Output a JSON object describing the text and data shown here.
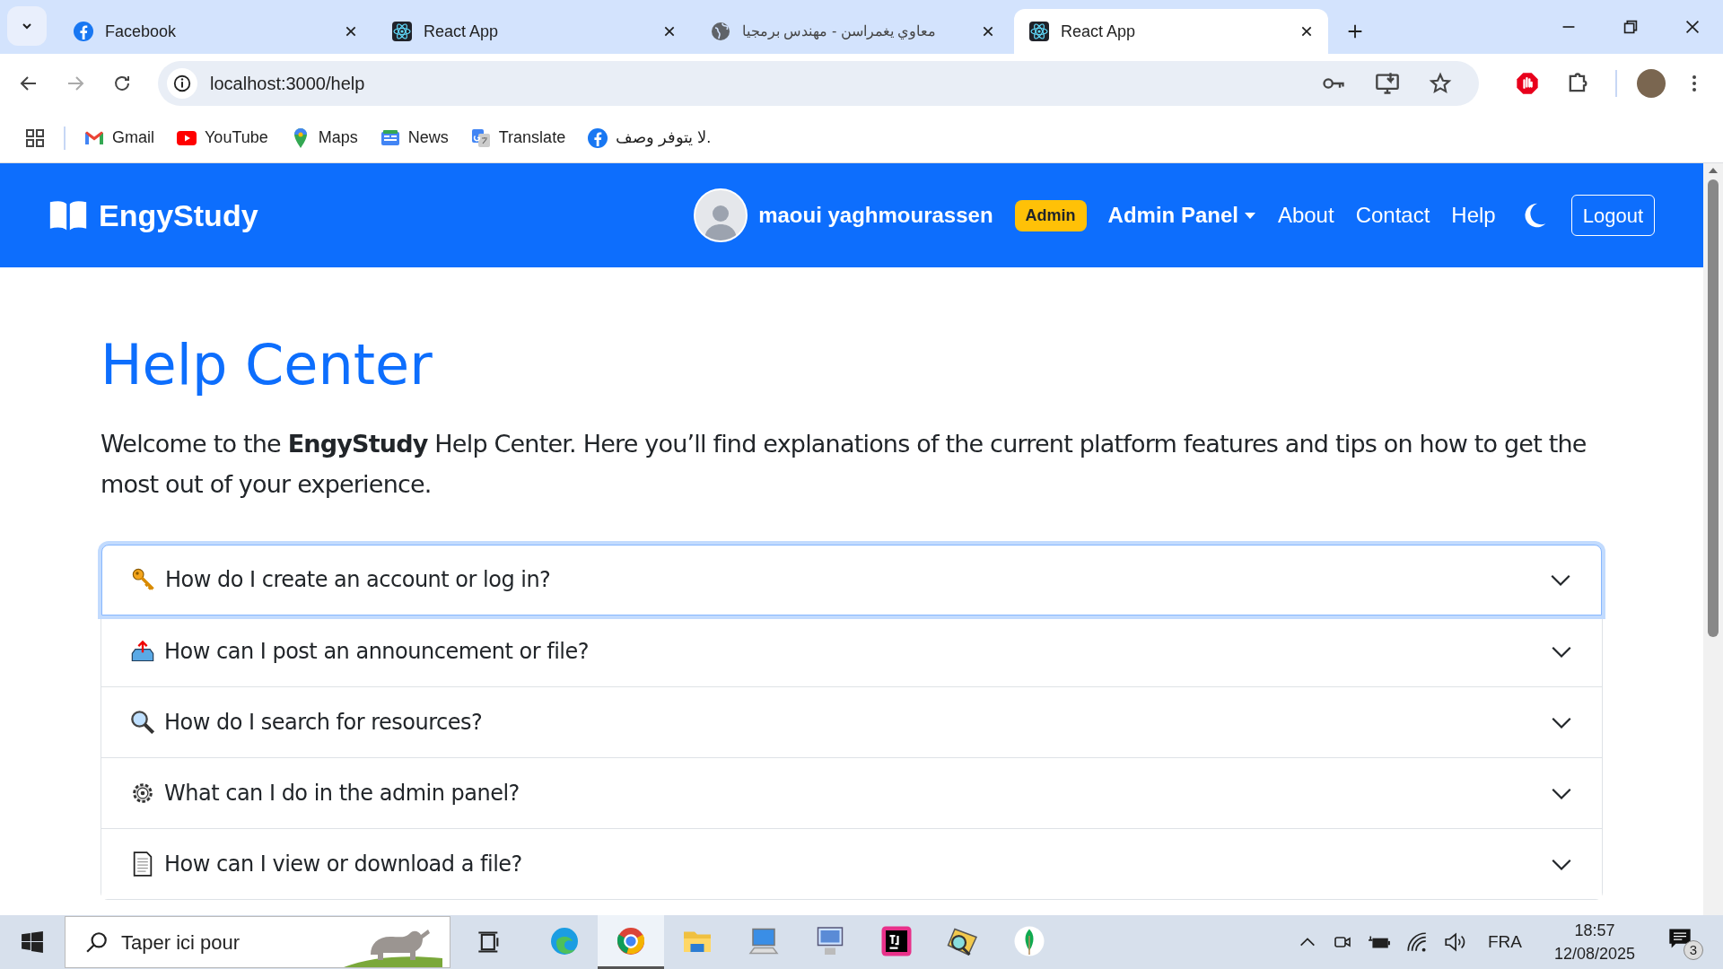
{
  "browser": {
    "tabs": [
      {
        "title": "Facebook",
        "selected": false
      },
      {
        "title": "React App",
        "selected": false
      },
      {
        "title": "معاوي يغمراسن - مهندس برمجيا",
        "selected": false
      },
      {
        "title": "React App",
        "selected": true
      }
    ],
    "address": "localhost:3000/help",
    "bookmarks": [
      "Gmail",
      "YouTube",
      "Maps",
      "News",
      "Translate",
      "لا يتوفر وصف."
    ]
  },
  "navbar": {
    "brand": "EngyStudy",
    "user": "maoui yaghmourassen",
    "role": "Admin",
    "links": [
      {
        "label": "Admin Panel",
        "kind": "dropdown"
      },
      {
        "label": "About",
        "kind": "link"
      },
      {
        "label": "Contact",
        "kind": "link"
      },
      {
        "label": "Help",
        "kind": "link"
      }
    ],
    "logout": "Logout"
  },
  "page": {
    "title": "Help Center",
    "intro": "Welcome to the **EngyStudy** Help Center. Here you’ll find explanations of the current platform features and tips on how to get the most out of your experience.",
    "faq": [
      {
        "question": "How do I create an account or log in?",
        "focused": true,
        "expanded": false
      },
      {
        "question": "How can I post an announcement or file?",
        "focused": false,
        "expanded": false
      },
      {
        "question": "How do I search for resources?",
        "focused": false,
        "expanded": false
      },
      {
        "question": "What can I do in the admin panel?",
        "focused": false,
        "expanded": false
      },
      {
        "question": "How can I view or download a file?",
        "focused": false,
        "expanded": false
      }
    ]
  },
  "taskbar": {
    "search_placeholder": "Taper ici pour",
    "apps": [
      {
        "selected": false
      },
      {
        "selected": true
      },
      {
        "selected": false
      },
      {
        "selected": false
      },
      {
        "selected": false
      },
      {
        "selected": false
      },
      {
        "selected": false
      },
      {
        "selected": false
      }
    ],
    "language": "FRA",
    "time": "18:57",
    "date": "12/08/2025",
    "notifications": "3"
  }
}
